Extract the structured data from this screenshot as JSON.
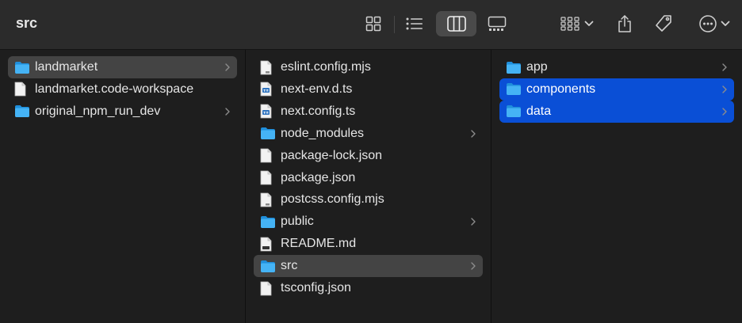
{
  "window": {
    "title": "src"
  },
  "toolbar": {
    "icons": [
      "grid-view-icon",
      "list-view-icon",
      "column-view-icon",
      "gallery-view-icon",
      "group-by-icon",
      "share-icon",
      "tag-icon",
      "more-icon"
    ]
  },
  "columns": [
    {
      "items": [
        {
          "label": "landmarket",
          "type": "folder",
          "has_children": true,
          "selected": "gray"
        },
        {
          "label": "landmarket.code-workspace",
          "type": "file",
          "has_children": false
        },
        {
          "label": "original_npm_run_dev",
          "type": "folder",
          "has_children": true
        }
      ]
    },
    {
      "items": [
        {
          "label": "eslint.config.mjs",
          "type": "file-js"
        },
        {
          "label": "next-env.d.ts",
          "type": "file-ts"
        },
        {
          "label": "next.config.ts",
          "type": "file-ts"
        },
        {
          "label": "node_modules",
          "type": "folder",
          "has_children": true
        },
        {
          "label": "package-lock.json",
          "type": "file"
        },
        {
          "label": "package.json",
          "type": "file"
        },
        {
          "label": "postcss.config.mjs",
          "type": "file-js"
        },
        {
          "label": "public",
          "type": "folder",
          "has_children": true
        },
        {
          "label": "README.md",
          "type": "file-md"
        },
        {
          "label": "src",
          "type": "folder",
          "has_children": true,
          "selected": "gray"
        },
        {
          "label": "tsconfig.json",
          "type": "file"
        }
      ]
    },
    {
      "items": [
        {
          "label": "app",
          "type": "folder",
          "has_children": true
        },
        {
          "label": "components",
          "type": "folder",
          "has_children": true,
          "selected": "blue"
        },
        {
          "label": "data",
          "type": "folder",
          "has_children": true,
          "selected": "blue"
        }
      ]
    }
  ],
  "colors": {
    "accent": "#0a4fd6",
    "folder": "#34aaf0",
    "toolbar": "#2b2b2b",
    "background": "#1e1e1e"
  }
}
